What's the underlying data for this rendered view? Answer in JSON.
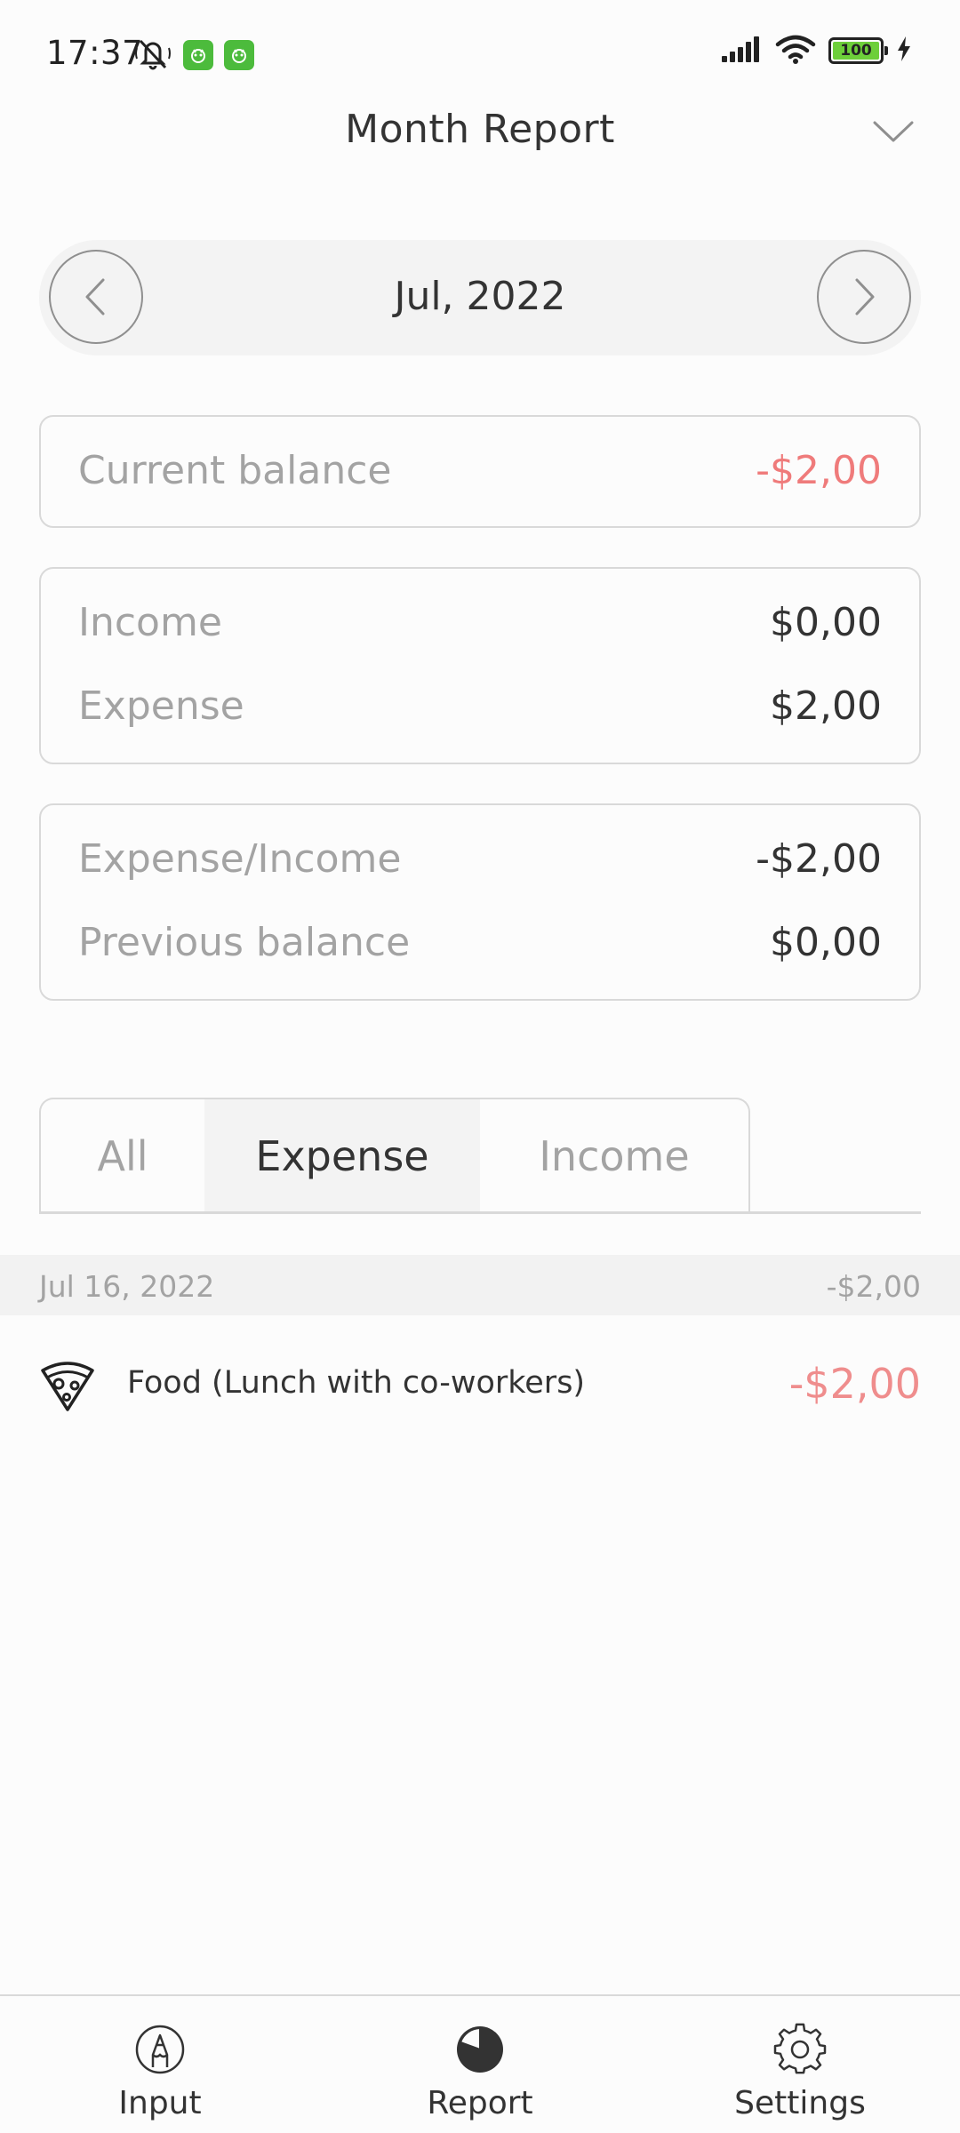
{
  "status_bar": {
    "time": "17:37",
    "battery_level": "100"
  },
  "header": {
    "title": "Month Report"
  },
  "month_nav": {
    "label": "Jul, 2022"
  },
  "balance_card": {
    "label": "Current balance",
    "value": "-$2,00"
  },
  "income_card": {
    "income_label": "Income",
    "income_value": "$0,00",
    "expense_label": "Expense",
    "expense_value": "$2,00"
  },
  "ratio_card": {
    "ratio_label": "Expense/Income",
    "ratio_value": "-$2,00",
    "previous_label": "Previous balance",
    "previous_value": "$0,00"
  },
  "tabs": {
    "all": "All",
    "expense": "Expense",
    "income": "Income",
    "selected": "Expense"
  },
  "transactions": {
    "groups": [
      {
        "date": "Jul 16, 2022",
        "total": "-$2,00",
        "items": [
          {
            "icon": "pizza-icon",
            "description": "Food (Lunch with co-workers)",
            "amount": "-$2,00"
          }
        ]
      }
    ]
  },
  "bottom_nav": {
    "input": "Input",
    "report": "Report",
    "settings": "Settings",
    "active": "Report"
  },
  "colors": {
    "negative": "#ef7b7b",
    "badge_green": "#4cbb3c",
    "battery_green": "#6dcf3a"
  }
}
